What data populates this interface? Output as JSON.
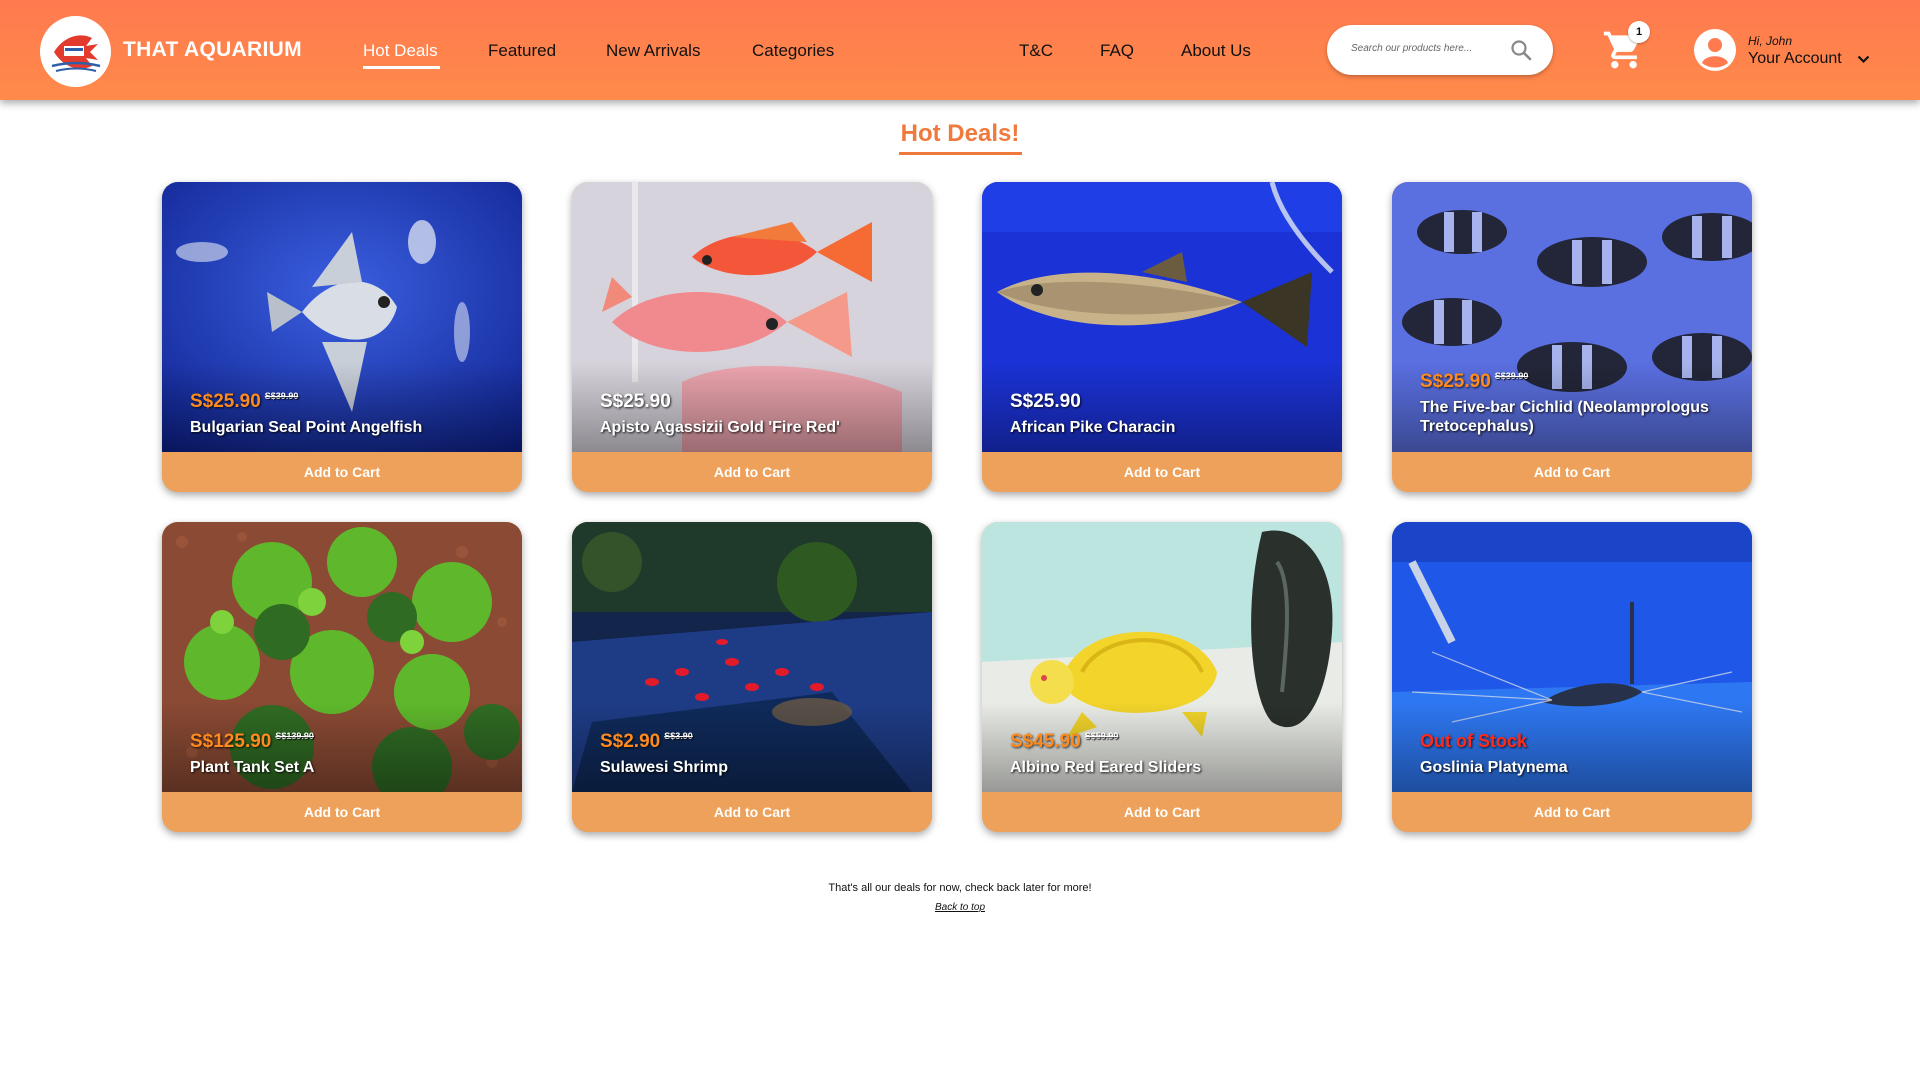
{
  "brand": {
    "name": "THAT AQUARIUM"
  },
  "nav": {
    "left": [
      "Hot Deals",
      "Featured",
      "New Arrivals",
      "Categories"
    ],
    "right": [
      "T&C",
      "FAQ",
      "About Us"
    ]
  },
  "search": {
    "placeholder": "Search our products here..."
  },
  "cart": {
    "count": "1"
  },
  "account": {
    "greeting": "Hi, John",
    "label": "Your Account"
  },
  "page": {
    "title": "Hot Deals!"
  },
  "products": [
    {
      "price": "S$25.90",
      "old_price": "S$39.90",
      "name": "Bulgarian Seal Point Angelfish",
      "button": "Add to Cart"
    },
    {
      "price": "S$25.90",
      "old_price": "",
      "name": "Apisto Agassizii Gold 'Fire Red'",
      "button": "Add to Cart"
    },
    {
      "price": "S$25.90",
      "old_price": "",
      "name": "African Pike Characin",
      "button": "Add to Cart"
    },
    {
      "price": "S$25.90",
      "old_price": "S$39.90",
      "name": "The Five-bar Cichlid (Neolamprologus Tretocephalus)",
      "button": "Add to Cart"
    },
    {
      "price": "S$125.90",
      "old_price": "S$139.90",
      "name": "Plant Tank Set A",
      "button": "Add to Cart"
    },
    {
      "price": "S$2.90",
      "old_price": "S$3.90",
      "name": "Sulawesi Shrimp",
      "button": "Add to Cart"
    },
    {
      "price": "S$45.90",
      "old_price": "S$59.90",
      "name": "Albino Red Eared Sliders",
      "button": "Add to Cart"
    },
    {
      "status": "Out of Stock",
      "name": "Goslinia Platynema",
      "button": "Add to Cart"
    }
  ],
  "footer": {
    "note": "That's all our deals for now, check back later for more!",
    "back_to_top": "Back to top"
  },
  "colors": {
    "header": "#ff7a4f",
    "accent": "#f07a3e",
    "button": "#eea15a",
    "sale_price": "#ff8a1e",
    "out_of_stock": "#ff2a1a"
  },
  "icons": [
    "logo-fish-icon",
    "search-icon",
    "cart-icon",
    "account-avatar-icon",
    "chevron-down-icon"
  ]
}
